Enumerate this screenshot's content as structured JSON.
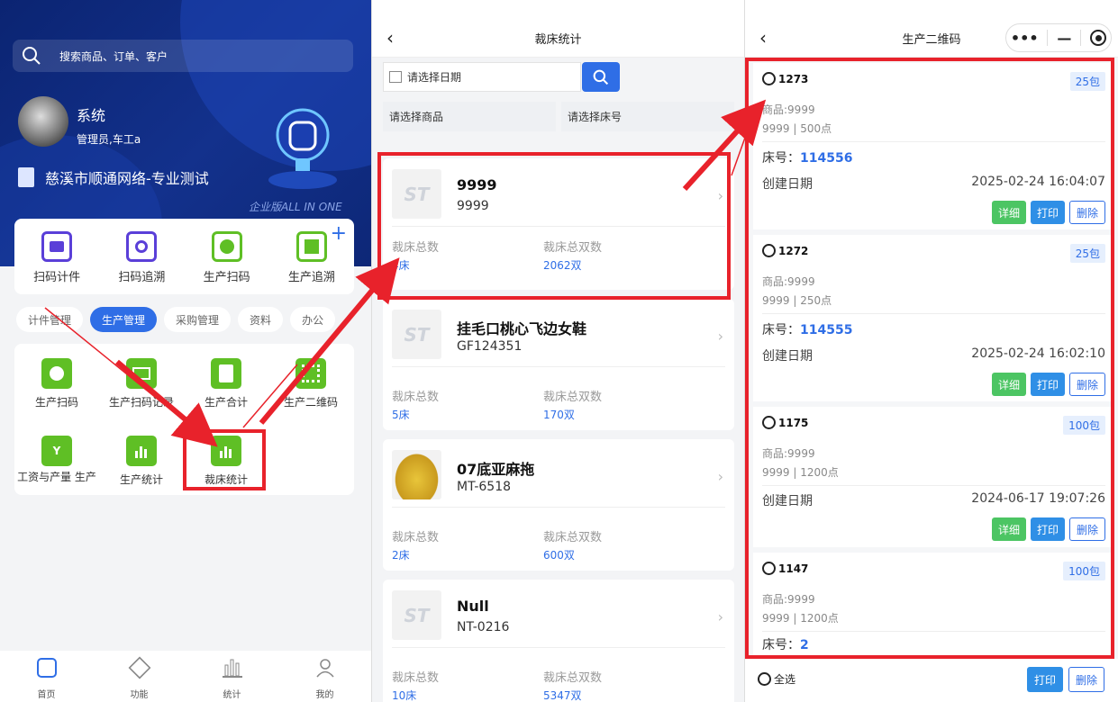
{
  "home": {
    "search_placeholder": "搜索商品、订单、客户",
    "user_name": "系统",
    "user_role": "管理员,车工a",
    "company": "慈溪市顺通网络-专业测试",
    "edition": "企业版ALL IN ONE",
    "quick": [
      {
        "label": "扫码计件",
        "icon": "scan-count-icon"
      },
      {
        "label": "扫码追溯",
        "icon": "scan-trace-icon"
      },
      {
        "label": "生产扫码",
        "icon": "production-scan-icon"
      },
      {
        "label": "生产追溯",
        "icon": "production-trace-icon"
      }
    ],
    "tabs": [
      "计件管理",
      "生产管理",
      "采购管理",
      "资料",
      "办公"
    ],
    "active_tab": "生产管理",
    "grid": [
      {
        "label": "生产扫码",
        "icon": "scan-icon"
      },
      {
        "label": "生产扫码记录",
        "icon": "scan-record-icon"
      },
      {
        "label": "生产合计",
        "icon": "clipboard-icon"
      },
      {
        "label": "生产二维码",
        "icon": "qrcode-icon"
      },
      {
        "label": "工资与产量 生产",
        "icon": "wage-icon"
      },
      {
        "label": "生产统计",
        "icon": "bar-chart-icon"
      },
      {
        "label": "裁床统计",
        "icon": "bar-chart-icon"
      }
    ],
    "tabbar": [
      "首页",
      "功能",
      "统计",
      "我的"
    ]
  },
  "cutting": {
    "title": "裁床统计",
    "date_placeholder": "请选择日期",
    "product_placeholder": "请选择商品",
    "bed_placeholder": "请选择床号",
    "thumb_watermark": "ST",
    "total_label": "裁床总数",
    "pairs_label": "裁床总双数",
    "items": [
      {
        "name": "9999",
        "code": "9999",
        "total": "4床",
        "pairs": "2062双"
      },
      {
        "name": "挂毛口桃心飞边女鞋",
        "code": "GF124351",
        "total": "5床",
        "pairs": "170双"
      },
      {
        "name": "07底亚麻拖",
        "code": "MT-6518",
        "total": "2床",
        "pairs": "600双"
      },
      {
        "name": "Null",
        "code": "NT-0216",
        "total": "10床",
        "pairs": "5347双"
      }
    ]
  },
  "qr": {
    "title": "生产二维码",
    "bed_label": "床号：",
    "created_label": "创建日期",
    "detail": "详细",
    "print": "打印",
    "delete": "删除",
    "select_all": "全选",
    "items": [
      {
        "id": "1273",
        "pack": "25包",
        "product": "商品:9999",
        "spec": "9999 | 500点",
        "bed": "114556",
        "date": "2025-02-24 16:04:07"
      },
      {
        "id": "1272",
        "pack": "25包",
        "product": "商品:9999",
        "spec": "9999 | 250点",
        "bed": "114555",
        "date": "2025-02-24 16:02:10"
      },
      {
        "id": "1175",
        "pack": "100包",
        "product": "商品:9999",
        "spec": "9999 | 1200点",
        "bed": "",
        "date": "2024-06-17 19:07:26"
      },
      {
        "id": "1147",
        "pack": "100包",
        "product": "商品:9999",
        "spec": "9999 | 1200点",
        "bed": "2",
        "date": ""
      }
    ]
  }
}
